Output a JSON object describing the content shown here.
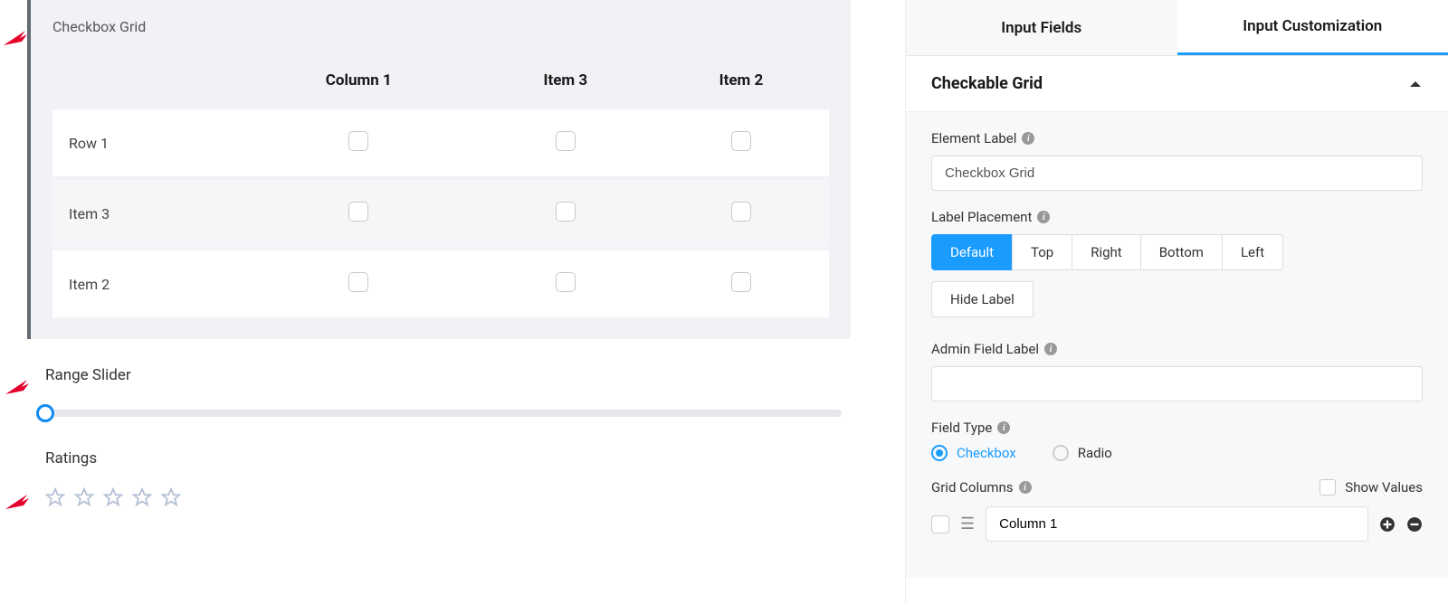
{
  "left": {
    "checkboxGrid": {
      "label": "Checkbox Grid",
      "columns": [
        "Column 1",
        "Item 3",
        "Item 2"
      ],
      "rows": [
        "Row 1",
        "Item 3",
        "Item 2"
      ]
    },
    "rangeSlider": {
      "label": "Range Slider"
    },
    "ratings": {
      "label": "Ratings",
      "count": 5
    }
  },
  "right": {
    "tabs": {
      "inputFields": "Input Fields",
      "inputCustomization": "Input Customization"
    },
    "section": {
      "title": "Checkable Grid"
    },
    "elementLabel": {
      "label": "Element Label",
      "value": "Checkbox Grid"
    },
    "labelPlacement": {
      "label": "Label Placement",
      "options": [
        "Default",
        "Top",
        "Right",
        "Bottom",
        "Left",
        "Hide Label"
      ],
      "active": "Default"
    },
    "adminFieldLabel": {
      "label": "Admin Field Label",
      "value": ""
    },
    "fieldType": {
      "label": "Field Type",
      "options": {
        "checkbox": "Checkbox",
        "radio": "Radio"
      },
      "selected": "checkbox"
    },
    "gridColumns": {
      "label": "Grid Columns",
      "showValues": "Show Values",
      "items": [
        {
          "value": "Column 1"
        }
      ]
    }
  }
}
